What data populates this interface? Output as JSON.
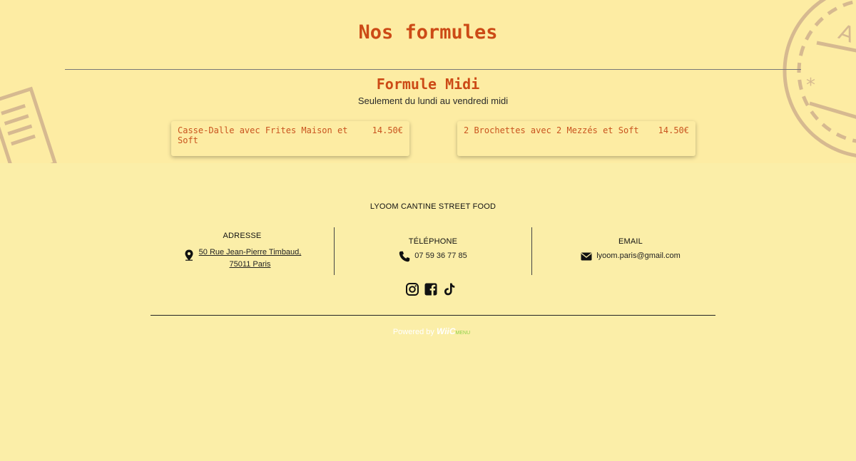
{
  "main": {
    "title": "Nos formules",
    "formule": {
      "title": "Formule Midi",
      "subtitle": "Seulement du lundi au vendredi midi",
      "items": [
        {
          "name": "Casse-Dalle avec Frites Maison et Soft",
          "price": "14.50€"
        },
        {
          "name": "2 Brochettes avec 2 Mezzés et Soft",
          "price": "14.50€"
        }
      ]
    }
  },
  "footer": {
    "brand": "LYOOM CANTINE STREET FOOD",
    "address": {
      "title": "ADRESSE",
      "line1": "50 Rue Jean-Pierre Timbaud,",
      "line2": "75011 Paris",
      "icon": "map-pin-icon"
    },
    "phone": {
      "title": "TÉLÉPHONE",
      "value": "07 59 36 77 85",
      "icon": "phone-icon"
    },
    "email": {
      "title": "EMAIL",
      "value": "lyoom.paris@gmail.com",
      "icon": "envelope-icon"
    },
    "social": [
      "instagram-icon",
      "facebook-icon",
      "tiktok-icon"
    ],
    "powered": {
      "prefix": "Powered by",
      "logo": "WiiC",
      "logo_suffix": "MENU"
    }
  },
  "colors": {
    "background": "#fbeea8",
    "accent": "#cc4a16"
  }
}
